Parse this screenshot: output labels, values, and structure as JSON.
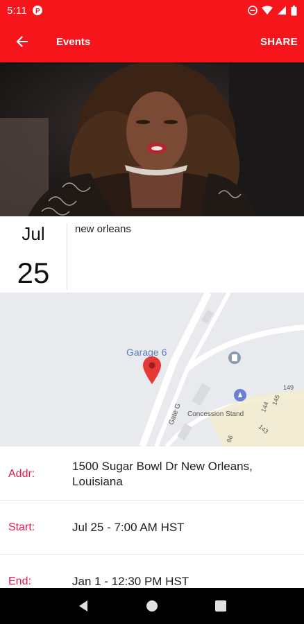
{
  "status_bar": {
    "time": "5:11",
    "app_icon": "p-icon",
    "icons": [
      "dnd-icon",
      "wifi-icon",
      "signal-icon",
      "battery-icon"
    ]
  },
  "app_bar": {
    "title": "Events",
    "share_label": "SHARE",
    "back_icon": "arrow-back-icon"
  },
  "hero": {
    "image": "performer-photo"
  },
  "event": {
    "month": "Jul",
    "day": "25",
    "title": "new orleans"
  },
  "map": {
    "labels": {
      "garage": "Garage 6",
      "concession": "Concession Stand",
      "gate": "Gate G",
      "n149": "149",
      "n145": "145",
      "n144": "144",
      "n143": "143",
      "n86": "86"
    },
    "pin": "map-pin-icon"
  },
  "details": {
    "address": {
      "label": "Addr:",
      "value_line1": "1500 Sugar Bowl Dr New Orleans,",
      "value_line2": "Louisiana"
    },
    "start": {
      "label": "Start:",
      "value": "Jul 25 - 7:00 AM HST"
    },
    "end": {
      "label": "End:",
      "value": "Jan 1 - 12:30 PM HST"
    }
  },
  "colors": {
    "primary": "#f5151b",
    "label": "#e8174a"
  },
  "nav": {
    "back": "nav-back-icon",
    "home": "nav-home-icon",
    "recents": "nav-recents-icon"
  }
}
